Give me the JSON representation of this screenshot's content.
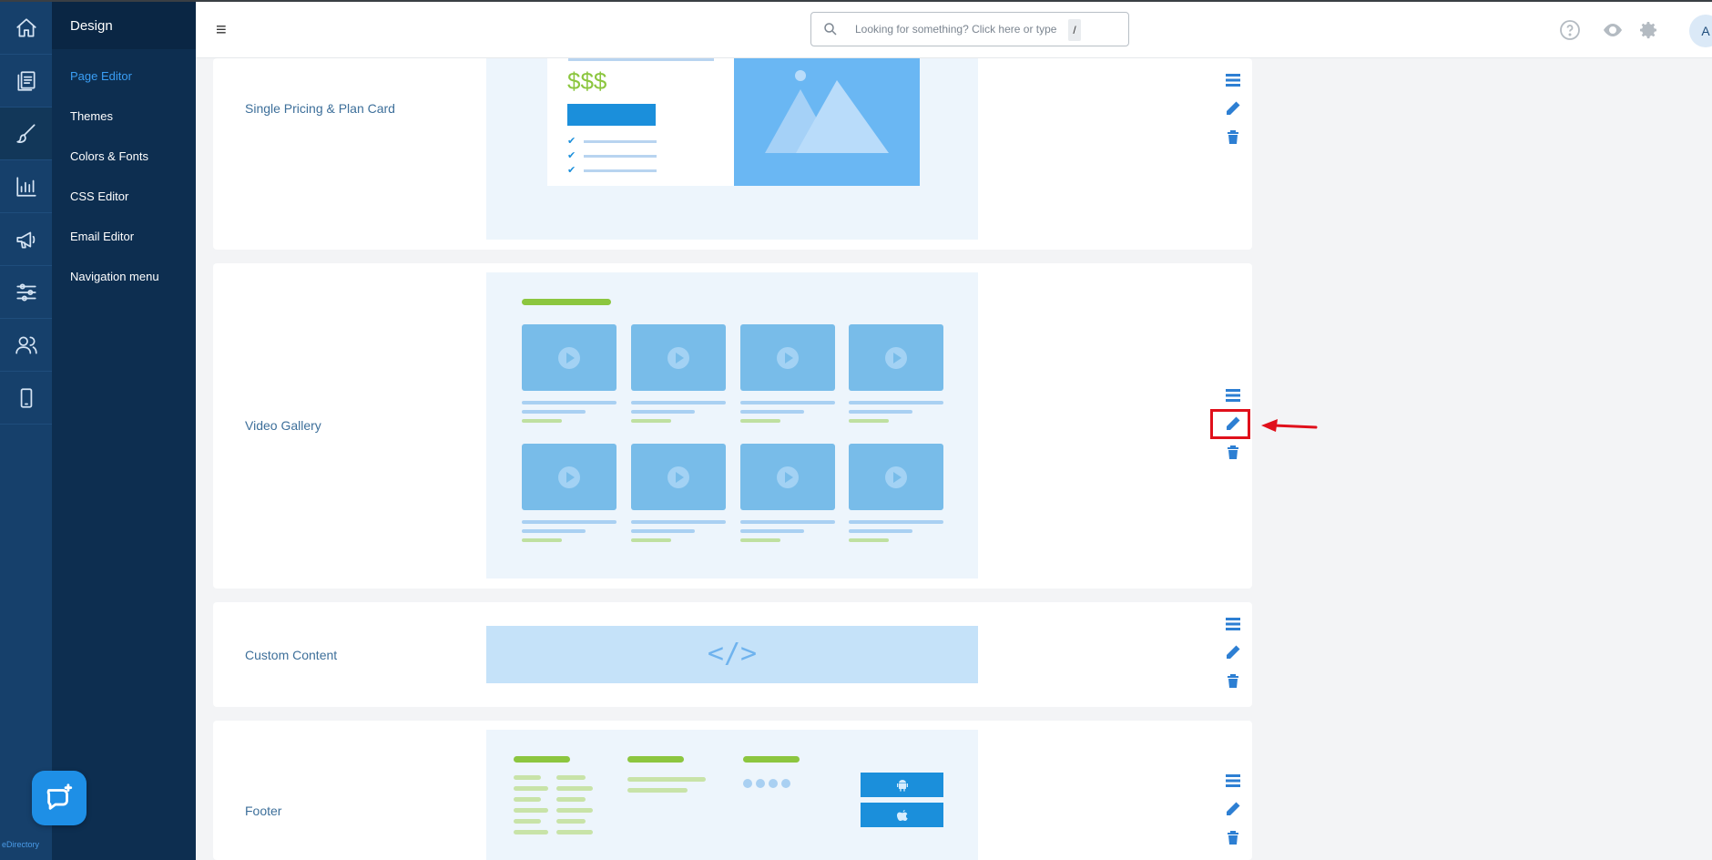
{
  "app": {
    "brand": "eDirectory"
  },
  "rail": {
    "items": [
      {
        "name": "home-icon"
      },
      {
        "name": "pages-icon"
      },
      {
        "name": "design-brush-icon"
      },
      {
        "name": "reports-chart-icon"
      },
      {
        "name": "promote-megaphone-icon"
      },
      {
        "name": "settings-sliders-icon"
      },
      {
        "name": "users-icon"
      },
      {
        "name": "mobile-app-icon"
      }
    ]
  },
  "sidebar": {
    "title": "Design",
    "items": [
      {
        "label": "Page Editor",
        "active": true
      },
      {
        "label": "Themes"
      },
      {
        "label": "Colors & Fonts"
      },
      {
        "label": "CSS Editor"
      },
      {
        "label": "Email Editor"
      },
      {
        "label": "Navigation menu"
      }
    ]
  },
  "header": {
    "search_placeholder": "Looking for something? Click here or type",
    "search_shortcut": "/",
    "avatar_initial": "A"
  },
  "widgets": [
    {
      "label": "Single Pricing & Plan Card",
      "preview": "pricing",
      "price_text": "$$$"
    },
    {
      "label": "Video Gallery",
      "preview": "video-gallery"
    },
    {
      "label": "Custom Content",
      "preview": "custom-code",
      "code_text": "</>"
    },
    {
      "label": "Footer",
      "preview": "footer"
    }
  ],
  "colors": {
    "rail_bg": "#16406b",
    "sidebar_bg": "#0d2e50",
    "accent": "#2d7fd3",
    "highlight": "#e0101b",
    "preview_green": "#8cc63f"
  }
}
